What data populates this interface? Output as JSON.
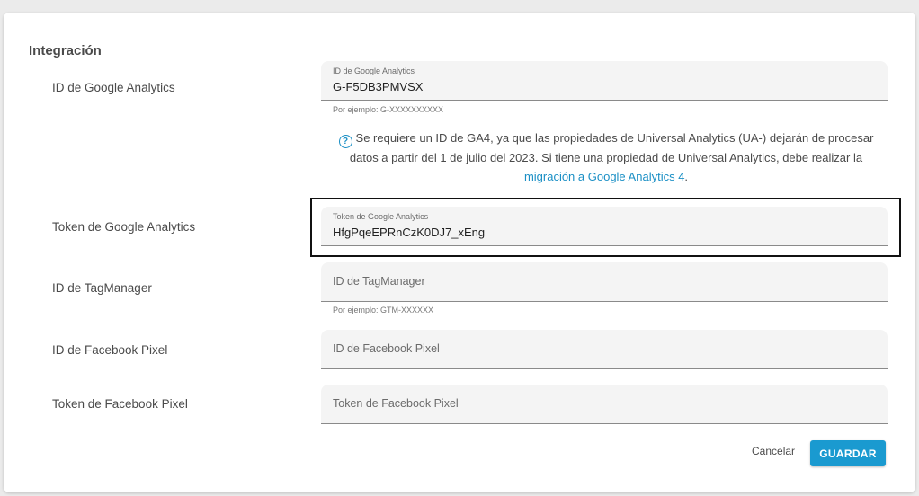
{
  "section": {
    "title": "Integración"
  },
  "ga_id": {
    "label": "ID de Google Analytics",
    "field_label": "ID de Google Analytics",
    "value": "G-F5DB3PMVSX",
    "hint": "Por ejemplo: G-XXXXXXXXXX"
  },
  "info": {
    "text": "Se requiere un ID de GA4, ya que las propiedades de Universal Analytics (UA-) dejarán de procesar datos a partir del 1 de julio del 2023. Si tiene una propiedad de Universal Analytics, debe realizar la",
    "link": "migración a Google Analytics 4",
    "suffix": "."
  },
  "ga_token": {
    "label": "Token de Google Analytics",
    "field_label": "Token de Google Analytics",
    "value": "HfgPqeEPRnCzK0DJ7_xEng"
  },
  "tagmanager": {
    "label": "ID de TagManager",
    "placeholder": "ID de TagManager",
    "hint": "Por ejemplo: GTM-XXXXXX"
  },
  "fb_pixel_id": {
    "label": "ID de Facebook Pixel",
    "placeholder": "ID de Facebook Pixel"
  },
  "fb_pixel_token": {
    "label": "Token de Facebook Pixel",
    "placeholder": "Token de Facebook Pixel"
  },
  "actions": {
    "cancel": "Cancelar",
    "save": "GUARDAR"
  },
  "colors": {
    "accent": "#1a9ad0",
    "link": "#1a8fc5"
  }
}
